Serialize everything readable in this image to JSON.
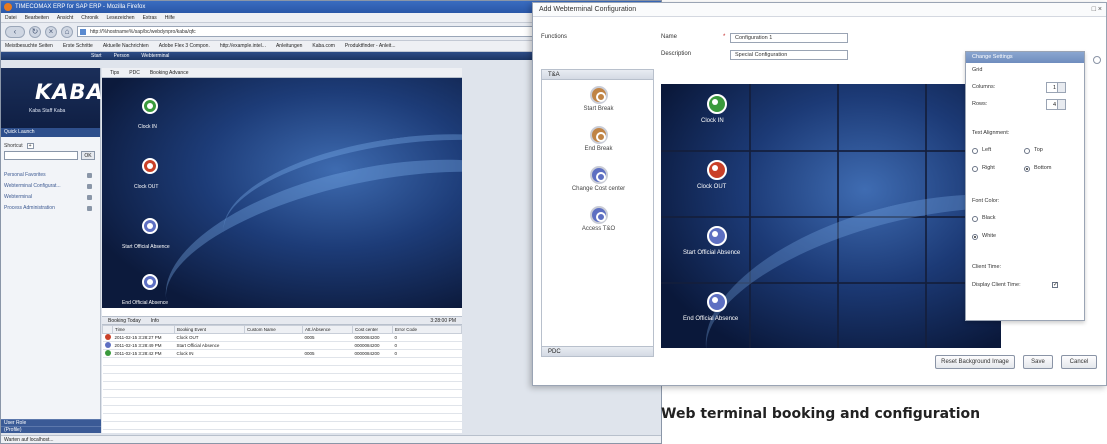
{
  "browser": {
    "title": "TIMECOMAX ERP for SAP ERP - Mozilla Firefox",
    "menu": [
      "Datei",
      "Bearbeiten",
      "Ansicht",
      "Chronik",
      "Lesezeichen",
      "Extras",
      "Hilfe"
    ],
    "url": "http://%hostname%/sap/bc/webdynpro/kaba/qfc",
    "bookmarks": [
      "Meistbesuchte Seiten",
      "Erste Schritte",
      "Aktuelle Nachrichten",
      "Adobe Flex 3 Compon.",
      "http://example.intel...",
      "Anleitungen",
      "Kaba.com",
      "Produktfinder - Anleit..."
    ],
    "appnav": [
      "Start",
      "Person",
      "Webterminal"
    ],
    "statusbar": "Warten auf localhost..."
  },
  "sidebar": {
    "logo": "KABA",
    "user": "Kaba Staff Kaba",
    "quicklaunch": "Quick Launch",
    "favorites_label": "Shortcut",
    "go_label": "OK",
    "items": [
      "Personal Favorites",
      "Webterminal Configurat...",
      "Webterminal",
      "Process Administration"
    ],
    "footer": [
      "User Role",
      "(Profile)"
    ]
  },
  "maincontent": {
    "tabs": [
      "Tips",
      "PDC",
      "Booking Advance"
    ],
    "buttons": [
      {
        "label": "Clock IN",
        "color": "g"
      },
      {
        "label": "Clock OUT",
        "color": "r"
      },
      {
        "label": "Start Official Absence",
        "color": "b"
      },
      {
        "label": "End Official Absence",
        "color": "b"
      }
    ],
    "booking_tabs": [
      "Booking Today",
      "Info"
    ],
    "clock": "3:28:00 PM",
    "table_headers": [
      "",
      "Time",
      "Booking Event",
      "Custom Name",
      "Att./Absence",
      "Cost center",
      "Error Code"
    ],
    "rows": [
      {
        "color": "#c94028",
        "time": "2011-02-15 3:28:27 PM",
        "event": "Clock OUT",
        "custom": "",
        "att": "0005",
        "cost": "0000084200",
        "err": "0"
      },
      {
        "color": "#5d6fc2",
        "time": "2011-02-15 3:28:49 PM",
        "event": "Start Official Absence",
        "custom": "",
        "att": "",
        "cost": "0000084200",
        "err": "0"
      },
      {
        "color": "#3a9a3c",
        "time": "2011-02-15 3:28:42 PM",
        "event": "Clock IN",
        "custom": "",
        "att": "0005",
        "cost": "0000084200",
        "err": "0"
      }
    ]
  },
  "dialog": {
    "title": "Add Webterminal Configuration",
    "functions_label": "Functions",
    "name_label": "Name",
    "name_value": "Configuration 1",
    "description_label": "Description",
    "description_value": "Special Configuration",
    "palette_head": "T&A",
    "palette_items": [
      {
        "label": "Start Break",
        "color": "o"
      },
      {
        "label": "End Break",
        "color": "o"
      },
      {
        "label": "Change Cost center",
        "color": "b"
      },
      {
        "label": "Access T&O",
        "color": "b"
      }
    ],
    "palette_foot": "PDC",
    "preview_buttons": [
      {
        "label": "Clock IN",
        "color": "g"
      },
      {
        "label": "Clock OUT",
        "color": "r"
      },
      {
        "label": "Start Official Absence",
        "color": "b"
      },
      {
        "label": "End Official Absence",
        "color": "b"
      }
    ],
    "buttons": [
      "Reset Background Image",
      "Save",
      "Cancel"
    ]
  },
  "charge": {
    "title": "Change Settings",
    "grid_label": "Grid",
    "columns_label": "Columns:",
    "columns_value": "1",
    "rows_label": "Rows:",
    "rows_value": "4",
    "text_alignment_label": "Text Alignment:",
    "left_label": "Left",
    "top_label": "Top",
    "right_label": "Right",
    "bottom_label": "Bottom",
    "font_color_label": "Font Color:",
    "black_label": "Black",
    "white_label": "White",
    "client_time_label": "Client Time:",
    "display_client_time_label": "Display Client Time:"
  },
  "caption": "Web terminal booking and configuration"
}
